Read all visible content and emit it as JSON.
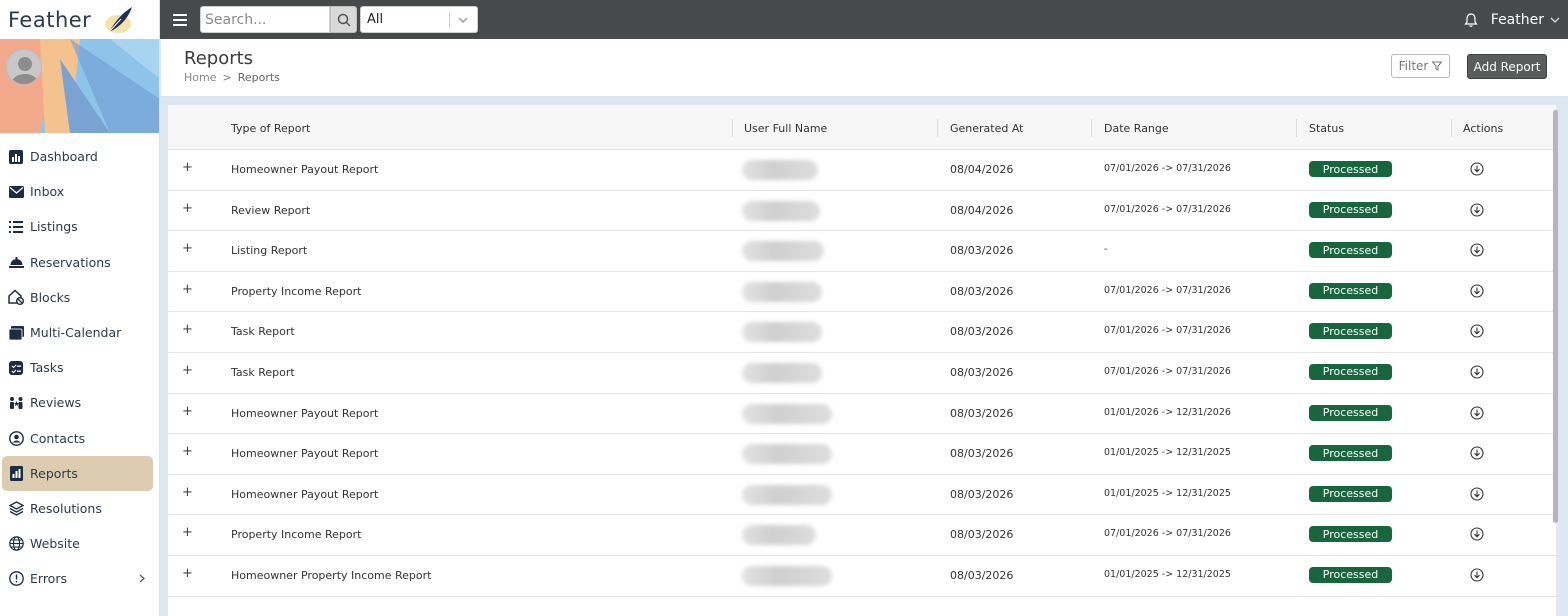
{
  "brand": {
    "name": "Feather"
  },
  "topbar": {
    "search_placeholder": "Search...",
    "scope_value": "All",
    "user_name": "Feather"
  },
  "sidebar": {
    "items": [
      {
        "label": "Dashboard",
        "icon": "dashboard-icon"
      },
      {
        "label": "Inbox",
        "icon": "envelope-icon"
      },
      {
        "label": "Listings",
        "icon": "list-icon"
      },
      {
        "label": "Reservations",
        "icon": "bell-service-icon"
      },
      {
        "label": "Blocks",
        "icon": "house-block-icon"
      },
      {
        "label": "Multi-Calendar",
        "icon": "calendar-icon"
      },
      {
        "label": "Tasks",
        "icon": "tasks-icon"
      },
      {
        "label": "Reviews",
        "icon": "reviews-icon"
      },
      {
        "label": "Contacts",
        "icon": "contact-icon"
      },
      {
        "label": "Reports",
        "icon": "report-icon",
        "active": true
      },
      {
        "label": "Resolutions",
        "icon": "layers-icon"
      },
      {
        "label": "Website",
        "icon": "globe-icon"
      },
      {
        "label": "Errors",
        "icon": "error-icon",
        "has_submenu": true
      }
    ]
  },
  "header": {
    "title": "Reports",
    "breadcrumb": [
      "Home",
      "Reports"
    ],
    "breadcrumb_sep": ">",
    "filter_label": "Filter",
    "add_label": "Add Report"
  },
  "table": {
    "columns": [
      "Type of Report",
      "User Full Name",
      "Generated At",
      "Date Range",
      "Status",
      "Actions"
    ],
    "expander": "+",
    "rows": [
      {
        "type": "Homeowner Payout Report",
        "generated": "08/04/2026",
        "range": "07/01/2026 -> 07/31/2026",
        "status": "Processed"
      },
      {
        "type": "Review Report",
        "generated": "08/04/2026",
        "range": "07/01/2026 -> 07/31/2026",
        "status": "Processed"
      },
      {
        "type": "Listing Report",
        "generated": "08/03/2026",
        "range": "-",
        "status": "Processed"
      },
      {
        "type": "Property Income Report",
        "generated": "08/03/2026",
        "range": "07/01/2026 -> 07/31/2026",
        "status": "Processed"
      },
      {
        "type": "Task Report",
        "generated": "08/03/2026",
        "range": "07/01/2026 -> 07/31/2026",
        "status": "Processed"
      },
      {
        "type": "Task Report",
        "generated": "08/03/2026",
        "range": "07/01/2026 -> 07/31/2026",
        "status": "Processed"
      },
      {
        "type": "Homeowner Payout Report",
        "generated": "08/03/2026",
        "range": "01/01/2026 -> 12/31/2026",
        "status": "Processed"
      },
      {
        "type": "Homeowner Payout Report",
        "generated": "08/03/2026",
        "range": "01/01/2025 -> 12/31/2025",
        "status": "Processed"
      },
      {
        "type": "Homeowner Payout Report",
        "generated": "08/03/2026",
        "range": "01/01/2025 -> 12/31/2025",
        "status": "Processed"
      },
      {
        "type": "Property Income Report",
        "generated": "08/03/2026",
        "range": "07/01/2026 -> 07/31/2026",
        "status": "Processed"
      },
      {
        "type": "Homeowner Property Income Report",
        "generated": "08/03/2026",
        "range": "01/01/2025 -> 12/31/2025",
        "status": "Processed"
      }
    ]
  },
  "colors": {
    "status_processed": "#17663e",
    "active_nav": "#dccdb1",
    "topbar": "#474a4a"
  }
}
